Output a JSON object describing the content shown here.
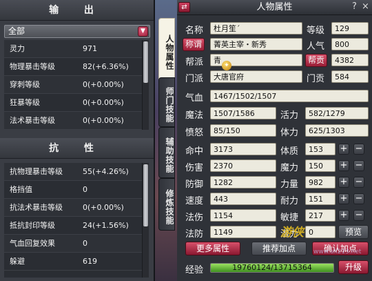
{
  "output_panel": {
    "title": "输 出",
    "filter": {
      "selected": "全部"
    },
    "rows": [
      {
        "label": "灵力",
        "value": "971"
      },
      {
        "label": "物理暴击等级",
        "value": "82(+6.36%)"
      },
      {
        "label": "穿刺等级",
        "value": "0(+0.00%)"
      },
      {
        "label": "狂暴等级",
        "value": "0(+0.00%)"
      },
      {
        "label": "法术暴击等级",
        "value": "0(+0.00%)"
      }
    ]
  },
  "resist_panel": {
    "title": "抗 性",
    "rows": [
      {
        "label": "抗物理暴击等级",
        "value": "55(+4.26%)"
      },
      {
        "label": "格挡值",
        "value": "0"
      },
      {
        "label": "抗法术暴击等级",
        "value": "0(+0.00%)"
      },
      {
        "label": "抵抗封印等级",
        "value": "24(+1.56%)"
      },
      {
        "label": "气血回复效果",
        "value": "0"
      },
      {
        "label": "躲避",
        "value": "619"
      }
    ]
  },
  "tabs": [
    {
      "label": "人物属性",
      "active": true
    },
    {
      "label": "师门技能",
      "active": false
    },
    {
      "label": "辅助技能",
      "active": false
    },
    {
      "label": "修炼技能",
      "active": false
    }
  ],
  "character": {
    "window_title": "人物属性",
    "help": "?",
    "close": "×",
    "name_label": "名称",
    "name": "杜月笙´",
    "level_label": "等级",
    "level": "129",
    "title_label": "称谓",
    "title": "菁英主宰・新秀",
    "popularity_label": "人气",
    "popularity": "800",
    "faction_label": "帮派",
    "faction": "青",
    "contribution_label": "帮贡",
    "contribution": "4382",
    "school_label": "门派",
    "school": "大唐官府",
    "school_contrib_label": "门贡",
    "school_contrib": "584",
    "hp_label": "气血",
    "hp": "1467/1502/1507",
    "mp_label": "魔法",
    "mp": "1507/1586",
    "vitality_label": "活力",
    "vitality": "582/1279",
    "anger_label": "愤怒",
    "anger": "85/150",
    "stamina_label": "体力",
    "stamina": "625/1303",
    "stats": [
      {
        "label": "命中",
        "value": "3173"
      },
      {
        "label": "伤害",
        "value": "2370"
      },
      {
        "label": "防御",
        "value": "1282"
      },
      {
        "label": "速度",
        "value": "443"
      },
      {
        "label": "法伤",
        "value": "1154"
      },
      {
        "label": "法防",
        "value": "1149"
      }
    ],
    "attributes": [
      {
        "label": "体质",
        "value": "153"
      },
      {
        "label": "魔力",
        "value": "150"
      },
      {
        "label": "力量",
        "value": "982"
      },
      {
        "label": "耐力",
        "value": "151"
      },
      {
        "label": "敏捷",
        "value": "217"
      }
    ],
    "potential_label": "潜力",
    "potential": "0",
    "preview_label": "预览",
    "more_attrs_label": "更多属性",
    "recommend_label": "推荐加点",
    "confirm_label": "确认加点",
    "exp_label": "经验",
    "exp": "19760124/13715364",
    "exp_fill": 1.0,
    "upgrade_label": "升级"
  },
  "watermark": "游侠",
  "watermark_url": "www.ali213.net",
  "colors": {
    "accent_red": "#b8304a",
    "field_bg": "#eceade",
    "panel_bg": "#2f3238"
  }
}
